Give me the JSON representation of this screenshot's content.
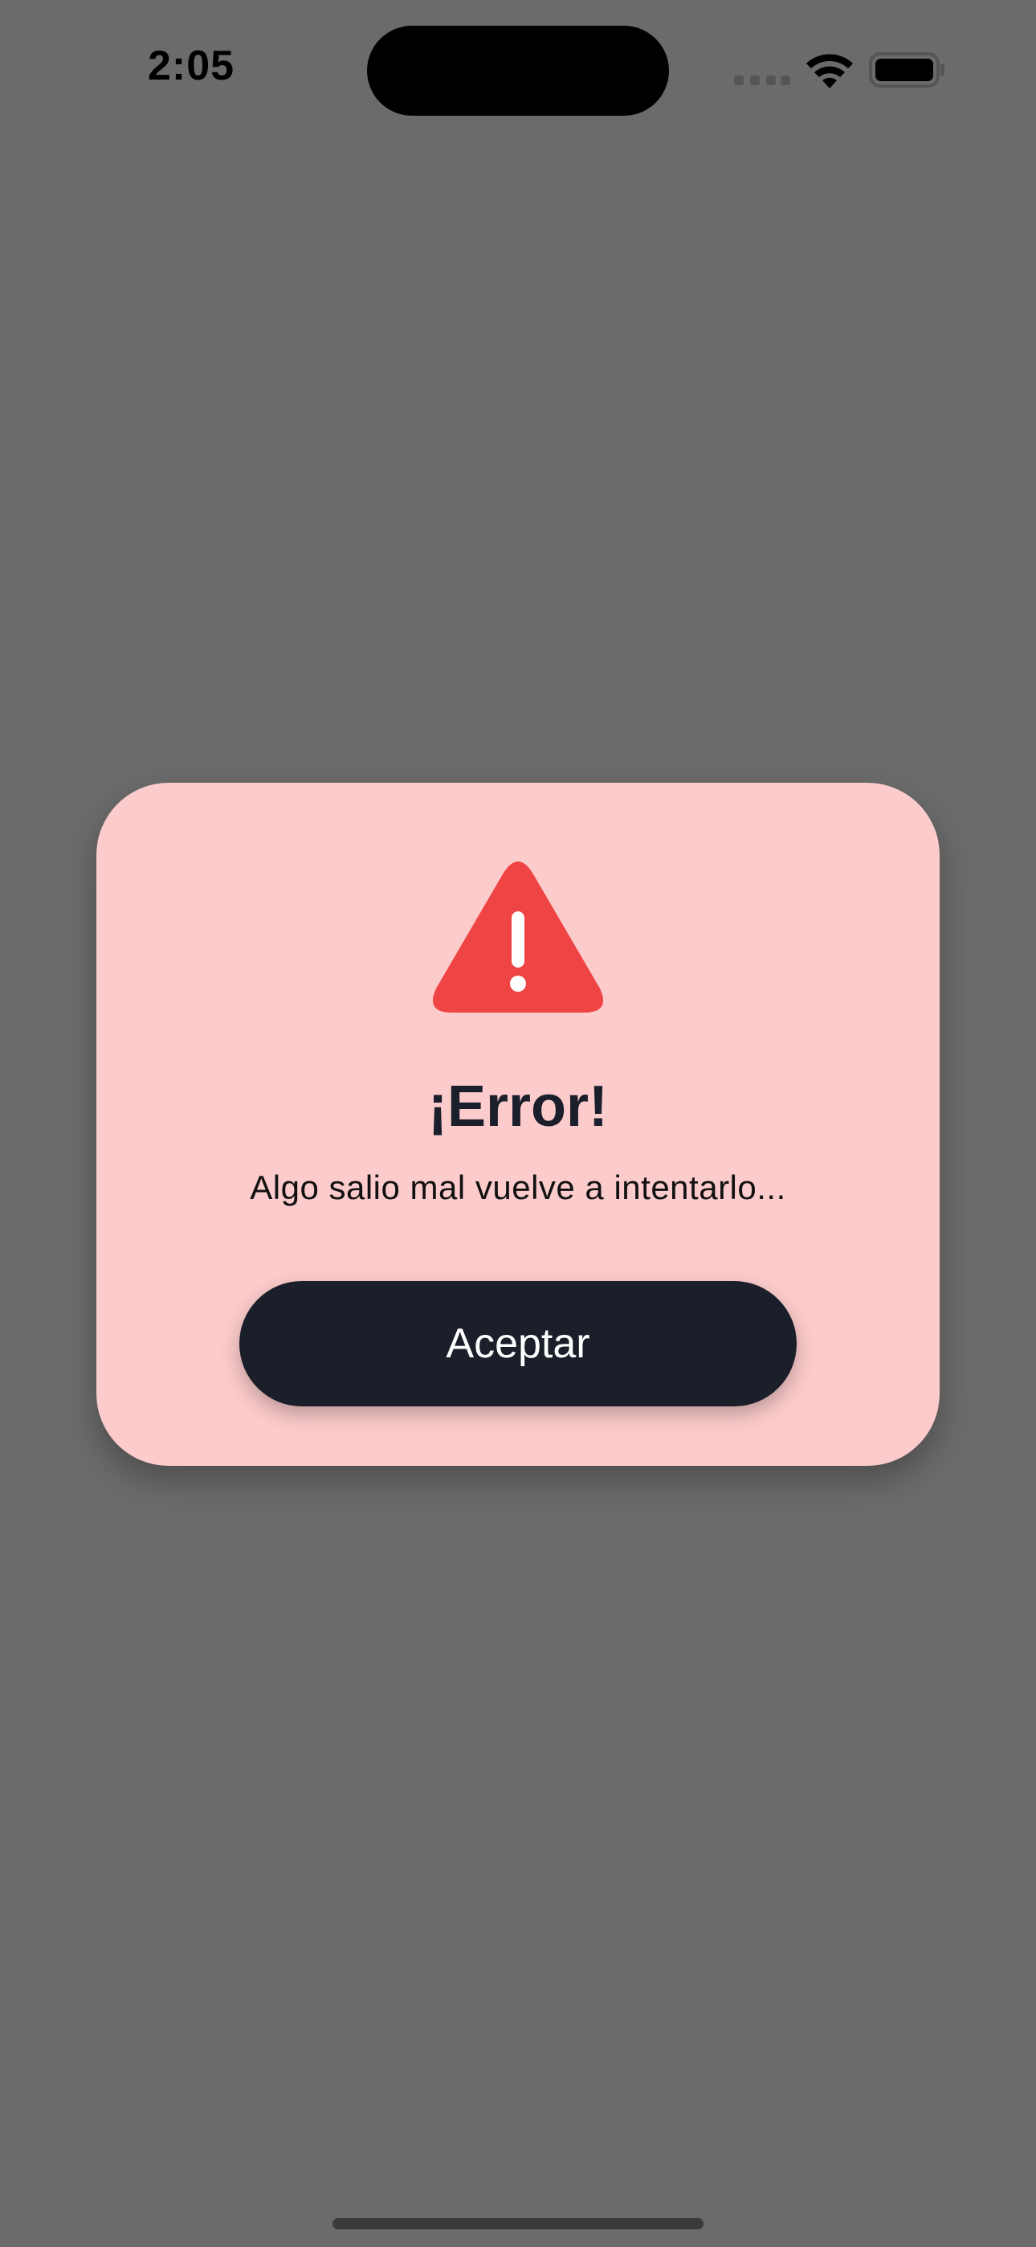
{
  "status_bar": {
    "time": "2:05"
  },
  "dialog": {
    "icon": "warning-triangle-icon",
    "title": "¡Error!",
    "message": "Algo salio mal vuelve a intentarlo...",
    "accept_label": "Aceptar"
  },
  "colors": {
    "overlay": "#6b6b6b",
    "card": "#fccbcb",
    "warning": "#ef4444",
    "button": "#1a1f29",
    "title": "#1b1f2c"
  }
}
